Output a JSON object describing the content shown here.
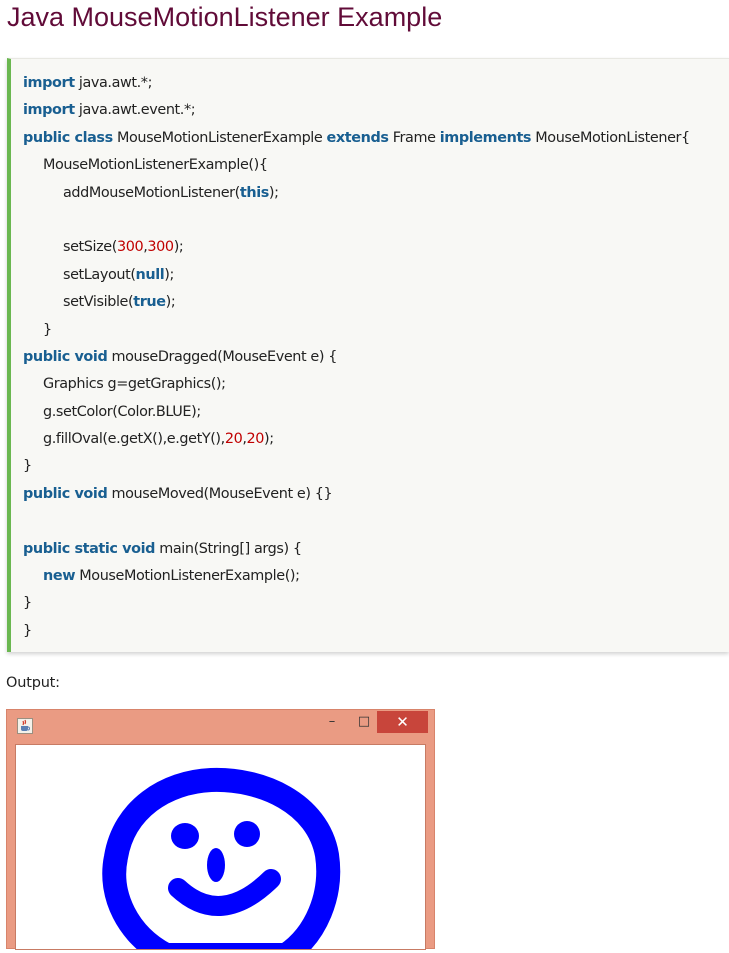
{
  "page": {
    "title": "Java MouseMotionListener Example",
    "output_label": "Output:"
  },
  "code_lines": [
    {
      "indent": 0,
      "tokens": [
        {
          "t": "import",
          "c": "kw"
        },
        {
          "t": " java.awt.*;",
          "c": ""
        }
      ]
    },
    {
      "indent": 0,
      "tokens": [
        {
          "t": "import",
          "c": "kw"
        },
        {
          "t": " java.awt.event.*;",
          "c": ""
        }
      ]
    },
    {
      "indent": 0,
      "tokens": [
        {
          "t": "public class",
          "c": "kw"
        },
        {
          "t": " MouseMotionListenerExample ",
          "c": ""
        },
        {
          "t": "extends",
          "c": "kw"
        },
        {
          "t": " Frame ",
          "c": ""
        },
        {
          "t": "implements",
          "c": "kw"
        },
        {
          "t": " MouseMotionListener{",
          "c": ""
        }
      ]
    },
    {
      "indent": 1,
      "tokens": [
        {
          "t": "MouseMotionListenerExample(){",
          "c": ""
        }
      ]
    },
    {
      "indent": 2,
      "tokens": [
        {
          "t": "addMouseMotionListener(",
          "c": ""
        },
        {
          "t": "this",
          "c": "kw"
        },
        {
          "t": ");",
          "c": ""
        }
      ]
    },
    {
      "indent": 2,
      "tokens": []
    },
    {
      "indent": 2,
      "tokens": [
        {
          "t": "setSize(",
          "c": ""
        },
        {
          "t": "300",
          "c": "num"
        },
        {
          "t": ",",
          "c": ""
        },
        {
          "t": "300",
          "c": "num"
        },
        {
          "t": ");",
          "c": ""
        }
      ]
    },
    {
      "indent": 2,
      "tokens": [
        {
          "t": "setLayout(",
          "c": ""
        },
        {
          "t": "null",
          "c": "kw"
        },
        {
          "t": ");",
          "c": ""
        }
      ]
    },
    {
      "indent": 2,
      "tokens": [
        {
          "t": "setVisible(",
          "c": ""
        },
        {
          "t": "true",
          "c": "kw"
        },
        {
          "t": ");",
          "c": ""
        }
      ]
    },
    {
      "indent": 1,
      "tokens": [
        {
          "t": "}",
          "c": ""
        }
      ]
    },
    {
      "indent": 0,
      "tokens": [
        {
          "t": "public void",
          "c": "kw"
        },
        {
          "t": " mouseDragged(MouseEvent e) {",
          "c": ""
        }
      ]
    },
    {
      "indent": 1,
      "tokens": [
        {
          "t": "Graphics g=getGraphics();",
          "c": ""
        }
      ]
    },
    {
      "indent": 1,
      "tokens": [
        {
          "t": "g.setColor(Color.BLUE);",
          "c": ""
        }
      ]
    },
    {
      "indent": 1,
      "tokens": [
        {
          "t": "g.fillOval(e.getX(),e.getY(),",
          "c": ""
        },
        {
          "t": "20",
          "c": "num"
        },
        {
          "t": ",",
          "c": ""
        },
        {
          "t": "20",
          "c": "num"
        },
        {
          "t": ");",
          "c": ""
        }
      ]
    },
    {
      "indent": 0,
      "tokens": [
        {
          "t": "}",
          "c": ""
        }
      ]
    },
    {
      "indent": 0,
      "tokens": [
        {
          "t": "public void",
          "c": "kw"
        },
        {
          "t": " mouseMoved(MouseEvent e) {}",
          "c": ""
        }
      ]
    },
    {
      "indent": 0,
      "tokens": []
    },
    {
      "indent": 0,
      "tokens": [
        {
          "t": "public static void",
          "c": "kw"
        },
        {
          "t": " main(String[] args) {",
          "c": ""
        }
      ]
    },
    {
      "indent": 1,
      "tokens": [
        {
          "t": "new",
          "c": "kw"
        },
        {
          "t": " MouseMotionListenerExample();",
          "c": ""
        }
      ]
    },
    {
      "indent": 0,
      "tokens": [
        {
          "t": "}",
          "c": ""
        }
      ]
    },
    {
      "indent": 0,
      "tokens": [
        {
          "t": "}",
          "c": ""
        }
      ]
    }
  ],
  "output_window": {
    "icon": "java-cup-icon",
    "minimize_glyph": "–",
    "maximize_glyph": "□",
    "close_glyph": "✕",
    "drawing": "smiley-face",
    "colors": {
      "frame": "#ea9b83",
      "close": "#c8453b",
      "drawing": "#0000ff"
    }
  },
  "colors": {
    "title": "#610b38",
    "keyword": "#195f91",
    "number": "#c00000",
    "code_accent_bar": "#6ab750",
    "code_background": "#f8f8f5"
  }
}
